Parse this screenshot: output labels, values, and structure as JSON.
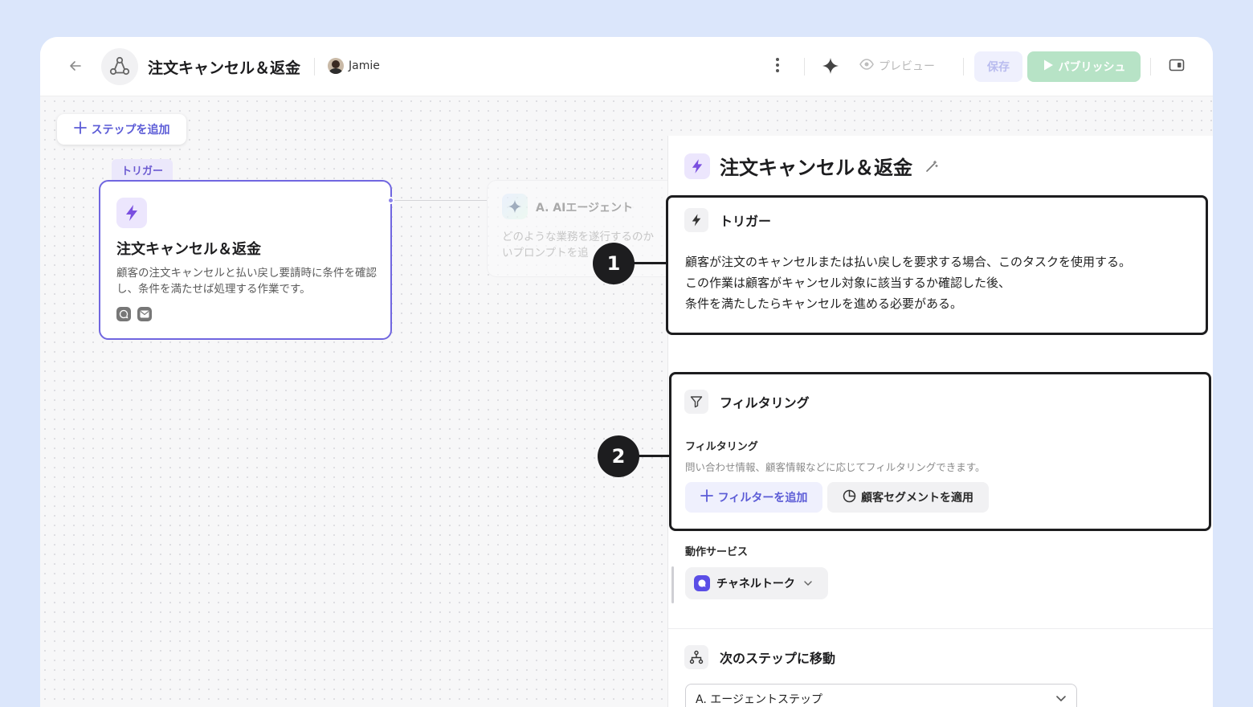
{
  "header": {
    "title": "注文キャンセル＆返金",
    "user_name": "Jamie",
    "preview_label": "プレビュー",
    "save_label": "保存",
    "publish_label": "パブリッシュ"
  },
  "canvas": {
    "add_step_label": "ステップを追加",
    "trigger_tag": "トリガー",
    "trigger_card": {
      "title": "注文キャンセル＆返金",
      "description": "顧客の注文キャンセルと払い戻し要請時に条件を確認し、条件を満たせば処理する作業です。"
    },
    "agent_card": {
      "title": "A. AIエージェント",
      "desc_line1": "どのような業務を遂行するのか",
      "desc_line2": "いプロンプトを追"
    }
  },
  "panel": {
    "title": "注文キャンセル＆返金",
    "trigger": {
      "section_title": "トリガー",
      "line1": "顧客が注文のキャンセルまたは払い戻しを要求する場合、このタスクを使用する。",
      "line2": "この作業は顧客がキャンセル対象に該当するか確認した後、",
      "line3": "条件を満たしたらキャンセルを進める必要がある。"
    },
    "filtering": {
      "section_title": "フィルタリング",
      "label": "フィルタリング",
      "help": "問い合わせ情報、顧客情報などに応じてフィルタリングできます。",
      "add_filter_label": "フィルターを追加",
      "segment_label": "顧客セグメントを適用"
    },
    "service": {
      "label": "動作サービス",
      "selected": "チャネルトーク"
    },
    "next_step": {
      "section_title": "次のステップに移動",
      "selected": "A. エージェントステップ"
    }
  },
  "callouts": {
    "badge1": "1",
    "badge2": "2"
  },
  "colors": {
    "accent": "#5b5bd6",
    "publish": "#b7e3c6",
    "background": "#dbe6fb"
  },
  "icons": [
    "arrow-left-icon",
    "app-logo-icon",
    "more-vertical-icon",
    "sparkle-icon",
    "eye-icon",
    "play-icon",
    "side-panel-icon",
    "plus-icon",
    "lightning-icon",
    "chat-icon",
    "mail-icon",
    "magic-wand-icon",
    "filter-icon",
    "pie-chart-icon",
    "channel-talk-icon",
    "chevron-down-icon",
    "flow-branch-icon"
  ]
}
